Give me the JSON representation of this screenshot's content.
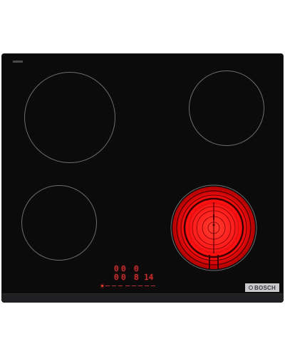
{
  "hob": {
    "brand": "BOSCH",
    "label_top_right": "",
    "cooking_zones": [
      {
        "id": "front-left",
        "state": "off"
      },
      {
        "id": "rear-left",
        "state": "off"
      },
      {
        "id": "rear-right",
        "state": "off"
      },
      {
        "id": "front-right",
        "state": "on"
      }
    ]
  },
  "control_panel": {
    "display_row1": "00 0",
    "display_row2": "00 8 14",
    "digits": [
      "0",
      "0",
      "0",
      "0",
      "0",
      "8",
      "14"
    ]
  },
  "colors": {
    "glass": "#0b0b0c",
    "zone_outline": "#6e6e70",
    "heat_red": "#ff1a1a",
    "display_red": "#e53232"
  }
}
